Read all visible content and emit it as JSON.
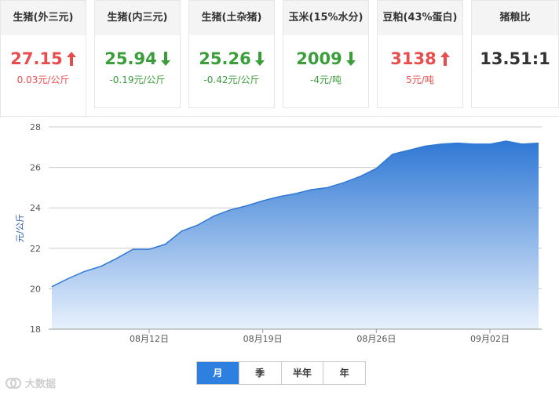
{
  "cards": [
    {
      "title": "生猪(外三元)",
      "value": "27.15",
      "change": "0.03元/公斤",
      "trend": "up"
    },
    {
      "title": "生猪(内三元)",
      "value": "25.94",
      "change": "-0.19元/公斤",
      "trend": "down"
    },
    {
      "title": "生猪(土杂猪)",
      "value": "25.26",
      "change": "-0.42元/公斤",
      "trend": "down"
    },
    {
      "title": "玉米(15%水分)",
      "value": "2009",
      "change": "-4元/吨",
      "trend": "down"
    },
    {
      "title": "豆粕(43%蛋白)",
      "value": "3138",
      "change": "5元/吨",
      "trend": "up"
    },
    {
      "title": "猪粮比",
      "value": "13.51:1",
      "change": "",
      "trend": "none"
    }
  ],
  "colors": {
    "up": "#e84d4d",
    "down": "#3a9e3a",
    "accent": "#2d7fe0",
    "area_top": "#2f78d4",
    "area_bottom": "#e8f1fc"
  },
  "tabs": [
    "月",
    "季",
    "半年",
    "年"
  ],
  "selected_tab": "月",
  "watermark": "大数据",
  "chart_data": {
    "type": "area",
    "ylabel": "元/公斤",
    "xlabel": "",
    "ylim": [
      18,
      28
    ],
    "yticks": [
      18,
      20,
      22,
      24,
      26,
      28
    ],
    "x_start": "08月06日",
    "xticks": [
      {
        "day": 6,
        "label": "08月12日"
      },
      {
        "day": 13,
        "label": "08月19日"
      },
      {
        "day": 20,
        "label": "08月26日"
      },
      {
        "day": 27,
        "label": "09月02日"
      }
    ],
    "values": [
      20.1,
      20.5,
      20.85,
      21.1,
      21.5,
      21.95,
      21.95,
      22.2,
      22.85,
      23.15,
      23.6,
      23.9,
      24.1,
      24.35,
      24.55,
      24.7,
      24.9,
      25.0,
      25.25,
      25.55,
      25.95,
      26.65,
      26.85,
      27.05,
      27.15,
      27.2,
      27.15,
      27.15,
      27.3,
      27.15,
      27.2
    ],
    "grid": true
  }
}
